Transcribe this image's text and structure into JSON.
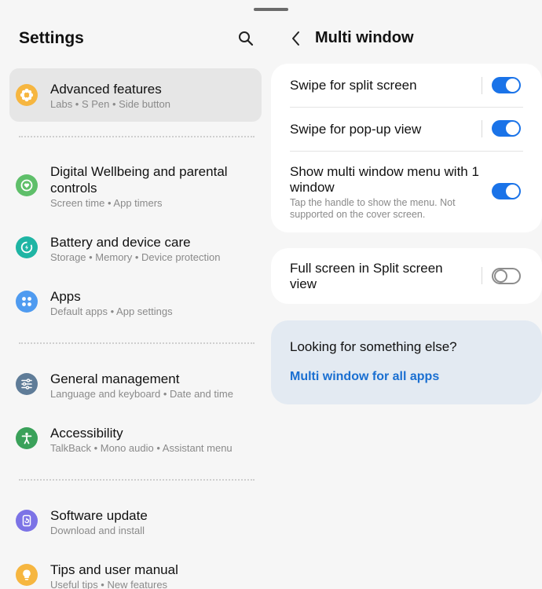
{
  "left": {
    "title": "Settings",
    "items": [
      {
        "title": "Advanced features",
        "sub": "Labs  •  S Pen  •  Side button",
        "icon": "gear-flower-icon",
        "color": "#f6b640"
      },
      {
        "title": "Digital Wellbeing and parental controls",
        "sub": "Screen time  •  App timers",
        "icon": "wellbeing-icon",
        "color": "#5fbf6a"
      },
      {
        "title": "Battery and device care",
        "sub": "Storage  •  Memory  •  Device protection",
        "icon": "device-care-icon",
        "color": "#1fb5a4"
      },
      {
        "title": "Apps",
        "sub": "Default apps  •  App settings",
        "icon": "apps-grid-icon",
        "color": "#4f9bf0"
      },
      {
        "title": "General management",
        "sub": "Language and keyboard  •  Date and time",
        "icon": "sliders-icon",
        "color": "#5f7c98"
      },
      {
        "title": "Accessibility",
        "sub": "TalkBack  •  Mono audio  •  Assistant menu",
        "icon": "accessibility-icon",
        "color": "#3aa15a"
      },
      {
        "title": "Software update",
        "sub": "Download and install",
        "icon": "software-update-icon",
        "color": "#7c73e6"
      },
      {
        "title": "Tips and user manual",
        "sub": "Useful tips  •  New features",
        "icon": "lightbulb-icon",
        "color": "#f6b640"
      }
    ]
  },
  "right": {
    "title": "Multi window",
    "settings": [
      {
        "title": "Swipe for split screen",
        "on": true
      },
      {
        "title": "Swipe for pop-up view",
        "on": true
      },
      {
        "title": "Show multi window menu with 1 window",
        "desc": "Tap the handle to show the menu. Not supported on the cover screen.",
        "on": true
      },
      {
        "title": "Full screen in Split screen view",
        "on": false
      }
    ],
    "info": {
      "title": "Looking for something else?",
      "link": "Multi window for all apps"
    }
  },
  "colors": {
    "accent": "#1a73e8",
    "link": "#1a6fd1"
  }
}
